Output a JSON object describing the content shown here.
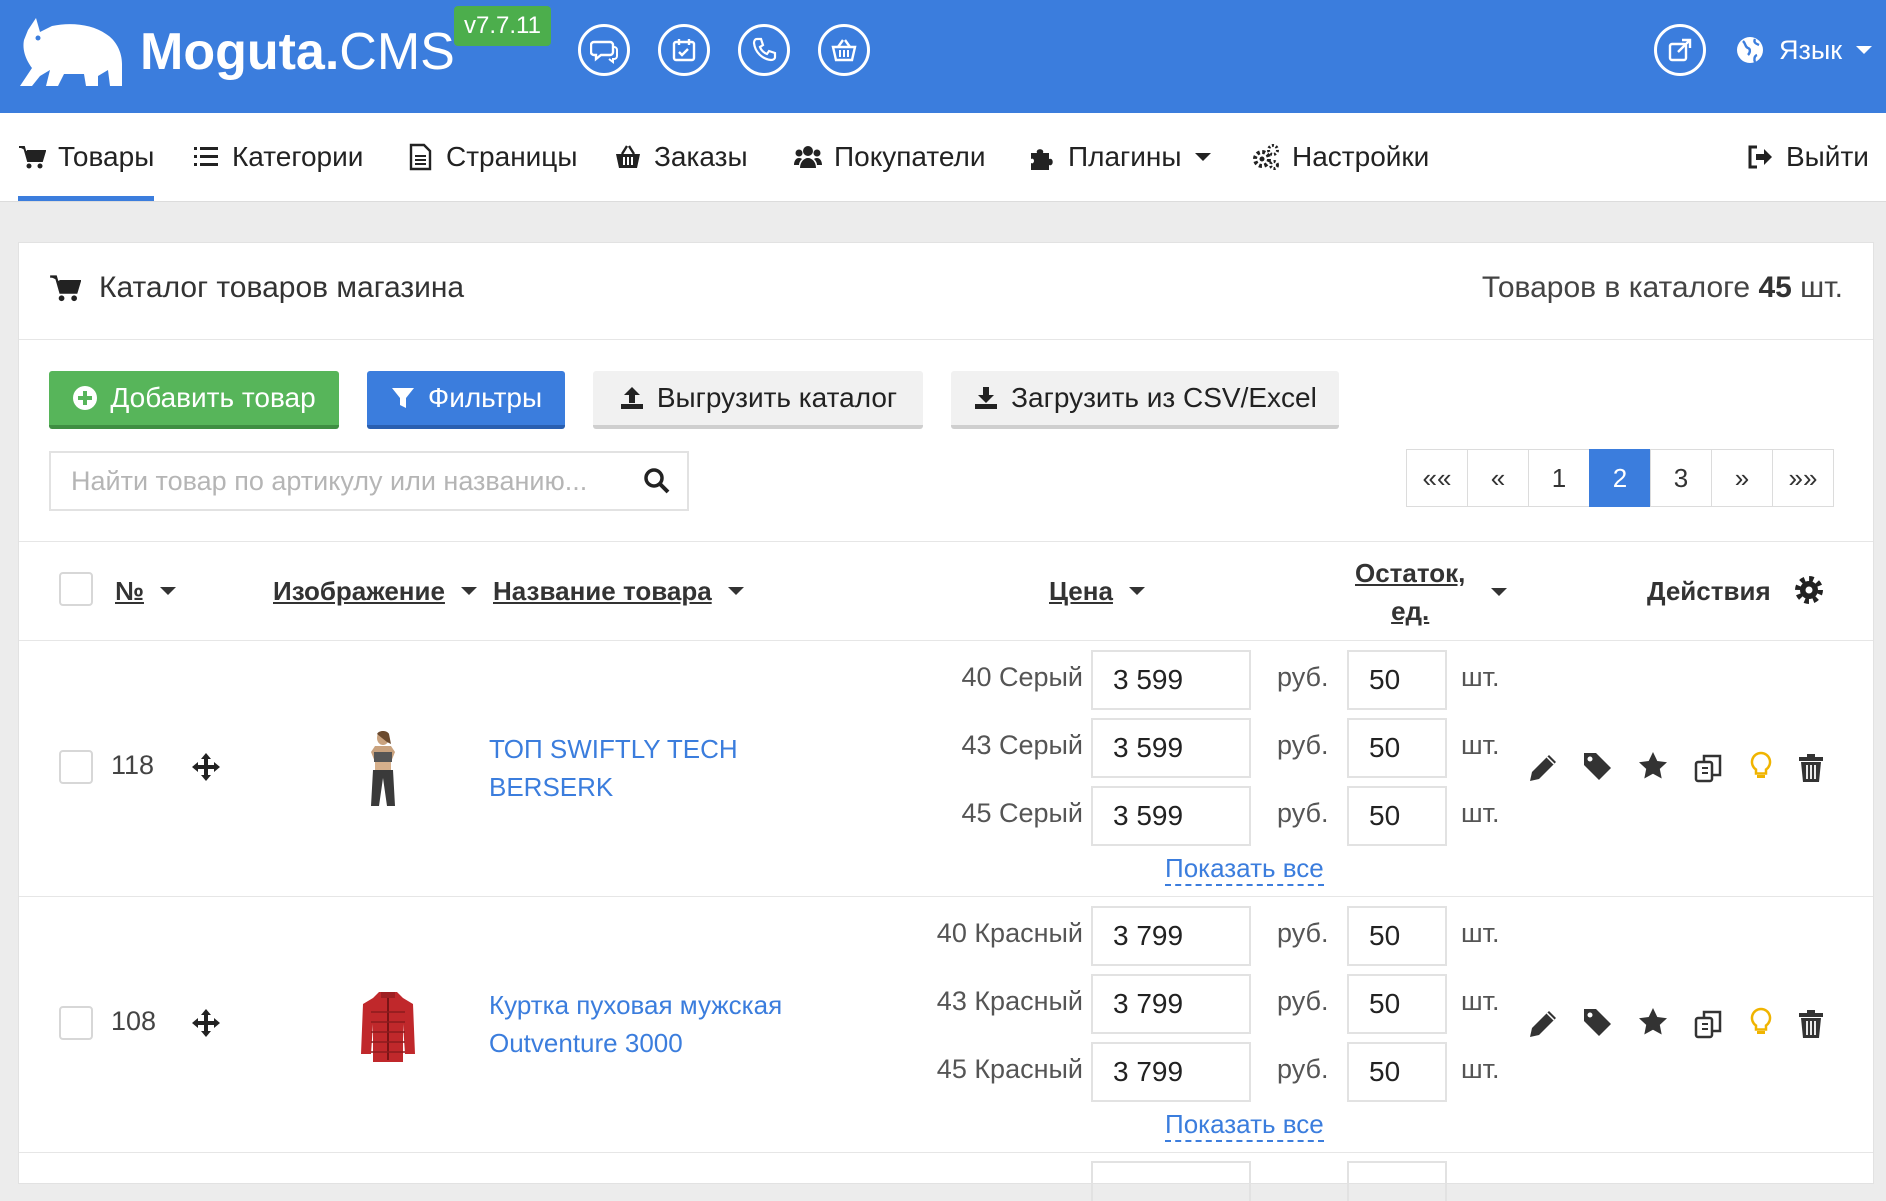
{
  "header": {
    "brand_bold": "Moguta",
    "brand_dot": ".",
    "brand_light": "CMS",
    "version": "v7.7.11",
    "icons": [
      "chat-icon",
      "calendar-icon",
      "phone-icon",
      "basket-icon"
    ],
    "lang_label": "Язык",
    "colors": {
      "header_bg": "#3b7ddd",
      "version_bg": "#4cae4c"
    }
  },
  "nav": {
    "items": [
      {
        "label": "Товары",
        "icon": "cart-icon",
        "active": true
      },
      {
        "label": "Категории",
        "icon": "list-icon"
      },
      {
        "label": "Страницы",
        "icon": "page-icon"
      },
      {
        "label": "Заказы",
        "icon": "basket-icon"
      },
      {
        "label": "Покупатели",
        "icon": "users-icon"
      },
      {
        "label": "Плагины",
        "icon": "puzzle-icon",
        "dropdown": true
      },
      {
        "label": "Настройки",
        "icon": "gears-icon"
      }
    ],
    "logout_label": "Выйти"
  },
  "catalog": {
    "title": "Каталог товаров магазина",
    "count_prefix": "Товаров в каталоге",
    "count_value": "45",
    "count_suffix": "шт."
  },
  "toolbar": {
    "add_label": "Добавить товар",
    "filters_label": "Фильтры",
    "export_label": "Выгрузить каталог",
    "import_label": "Загрузить из CSV/Excel"
  },
  "search": {
    "placeholder": "Найти товар по артикулу или названию..."
  },
  "pagination": {
    "first": "««",
    "prev": "«",
    "pages": [
      "1",
      "2",
      "3"
    ],
    "current": "2",
    "next": "»",
    "last": "»»"
  },
  "table": {
    "headers": {
      "number": "№",
      "image": "Изображение",
      "name": "Название товара",
      "price": "Цена",
      "stock_line1": "Остаток,",
      "stock_line2": "ед.",
      "actions": "Действия"
    },
    "currency": "руб.",
    "unit": "шт.",
    "show_all": "Показать все",
    "rows": [
      {
        "id": "118",
        "name_line1": "ТОП SWIFTLY TECH",
        "name_line2": "BERSERK",
        "variants": [
          {
            "label": "40 Серый",
            "price": "3 599",
            "stock": "50"
          },
          {
            "label": "43 Серый",
            "price": "3 599",
            "stock": "50"
          },
          {
            "label": "45 Серый",
            "price": "3 599",
            "stock": "50"
          }
        ]
      },
      {
        "id": "108",
        "name_line1": "Куртка пуховая мужская",
        "name_line2": "Outventure 3000",
        "variants": [
          {
            "label": "40 Красный",
            "price": "3 799",
            "stock": "50"
          },
          {
            "label": "43 Красный",
            "price": "3 799",
            "stock": "50"
          },
          {
            "label": "45 Красный",
            "price": "3 799",
            "stock": "50"
          }
        ]
      }
    ]
  }
}
